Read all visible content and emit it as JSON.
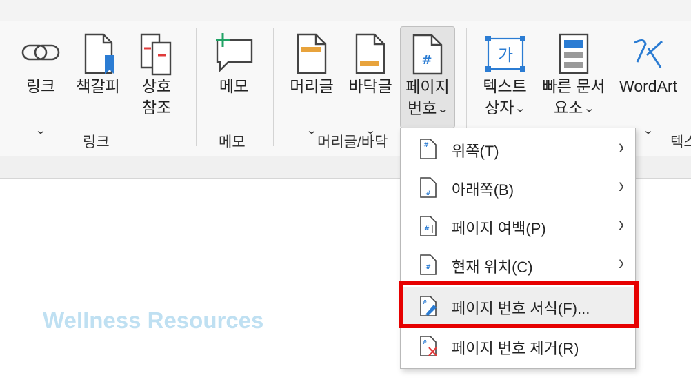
{
  "ribbon": {
    "groups": [
      {
        "label": "링크",
        "buttons": [
          {
            "label": "링크",
            "icon": "link-icon",
            "has_dropdown": true
          },
          {
            "label": "책갈피",
            "icon": "bookmark-icon",
            "has_dropdown": false
          },
          {
            "label_line1": "상호",
            "label_line2": "참조",
            "icon": "cross-reference-icon",
            "has_dropdown": false
          }
        ]
      },
      {
        "label": "메모",
        "buttons": [
          {
            "label": "메모",
            "icon": "comment-icon",
            "has_dropdown": false
          }
        ]
      },
      {
        "label": "머리글/바닥",
        "buttons": [
          {
            "label": "머리글",
            "icon": "header-icon",
            "has_dropdown": true
          },
          {
            "label": "바닥글",
            "icon": "footer-icon",
            "has_dropdown": true
          },
          {
            "label_line1": "페이지",
            "label_line2": "번호",
            "icon": "page-number-icon",
            "has_dropdown": true,
            "active": true
          }
        ]
      },
      {
        "label": "텍스",
        "buttons": [
          {
            "label_line1": "텍스트",
            "label_line2": "상자",
            "icon": "text-box-icon",
            "has_dropdown": true
          },
          {
            "label_line1": "빠른 문서",
            "label_line2": "요소",
            "icon": "quick-parts-icon",
            "has_dropdown": true
          },
          {
            "label": "WordArt",
            "icon": "wordart-icon",
            "has_dropdown": true
          }
        ]
      }
    ],
    "dropdown_glyph": "⌄",
    "text_box_glyph": "가"
  },
  "page_number_menu": {
    "items": [
      {
        "text": "위쪽(T)",
        "icon": "page-top-icon",
        "submenu": true
      },
      {
        "text": "아래쪽(B)",
        "icon": "page-bottom-icon",
        "submenu": true
      },
      {
        "text": "페이지 여백(P)",
        "icon": "page-margin-icon",
        "submenu": true
      },
      {
        "text": "현재 위치(C)",
        "icon": "current-position-icon",
        "submenu": true
      },
      {
        "text": "페이지 번호 서식(F)...",
        "icon": "format-page-number-icon",
        "submenu": false,
        "highlighted": true
      },
      {
        "text": "페이지 번호 제거(R)",
        "icon": "remove-page-number-icon",
        "submenu": false
      }
    ],
    "arrow_glyph": "›"
  },
  "document": {
    "watermark": "Wellness Resources"
  },
  "colors": {
    "accent_blue": "#2b7cd3",
    "header_orange": "#e8a33c",
    "comment_green": "#21a366",
    "highlight_red": "#e60000",
    "watermark": "#bfe0f2"
  }
}
